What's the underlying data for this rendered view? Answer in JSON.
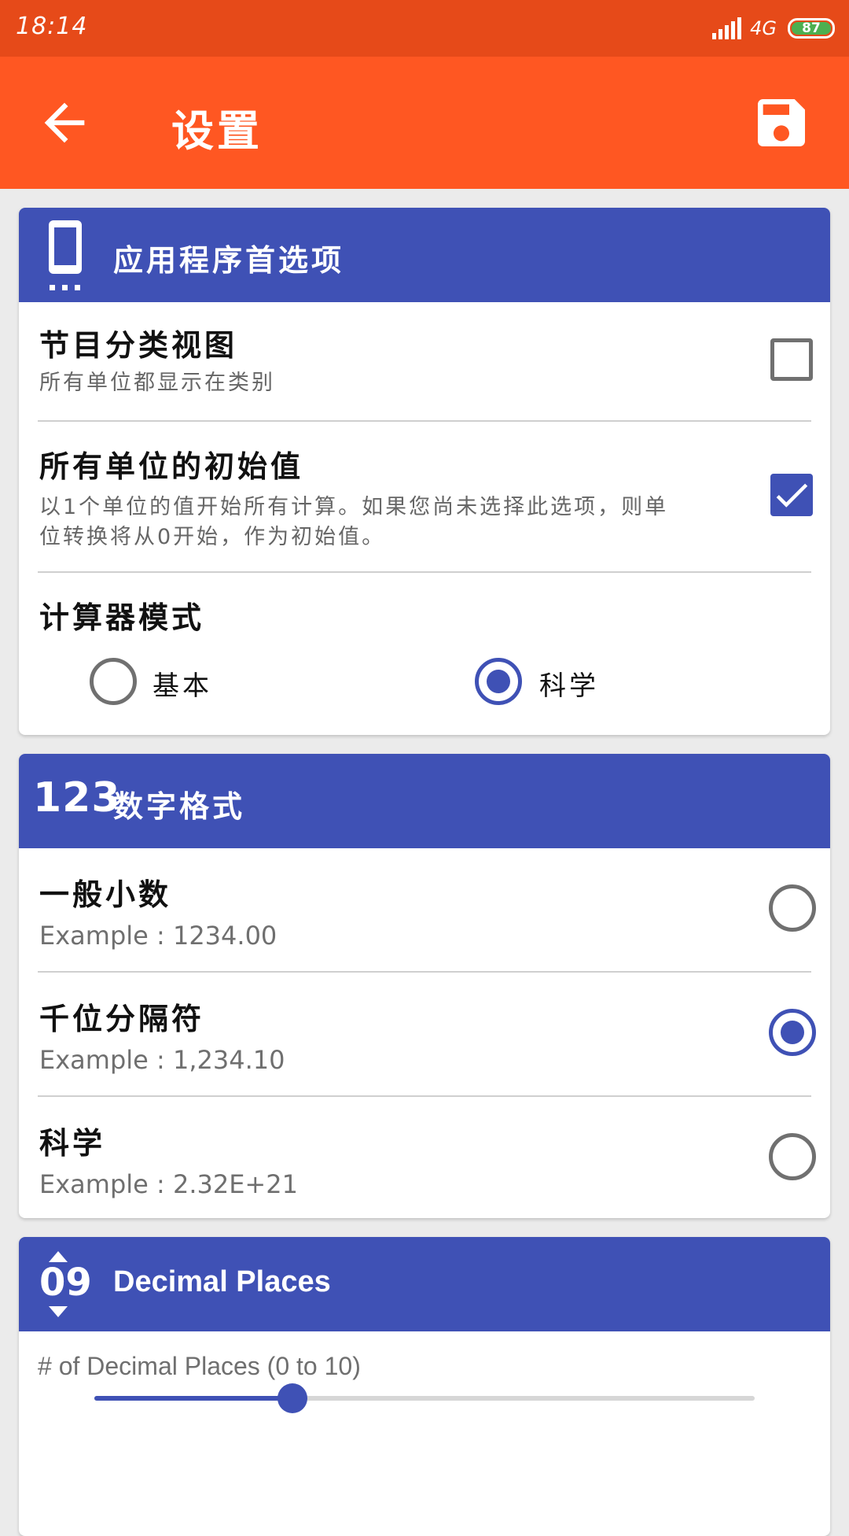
{
  "status_bar": {
    "time": "18:14",
    "network": "4G",
    "battery": "87"
  },
  "app_bar": {
    "title": "设置"
  },
  "app_prefs": {
    "header": "应用程序首选项",
    "category_view": {
      "title": "节目分类视图",
      "subtitle": "所有单位都显示在类别",
      "checked": false
    },
    "initial_value": {
      "title": "所有单位的初始值",
      "subtitle_line1": "以1个单位的值开始所有计算。如果您尚未选择此选项，则单",
      "subtitle_line2": "位转换将从0开始，作为初始值。",
      "checked": true
    },
    "calculator_mode": {
      "title": "计算器模式",
      "options": [
        {
          "label": "基本",
          "selected": false
        },
        {
          "label": "科学",
          "selected": true
        }
      ]
    }
  },
  "number_format": {
    "header": "数字格式",
    "icon_text": "123",
    "options": [
      {
        "title": "一般小数",
        "example": "Example : 1234.00",
        "selected": false
      },
      {
        "title": "千位分隔符",
        "example": "Example : 1,234.10",
        "selected": true
      },
      {
        "title": "科学",
        "example": "Example : 2.32E+21",
        "selected": false
      }
    ]
  },
  "decimal_places": {
    "header": "Decimal Places",
    "icon_text": "09",
    "label": "# of Decimal Places (0 to 10)",
    "value_fraction": 0.3,
    "min": 0,
    "max": 10
  },
  "colors": {
    "status_bar": "#e64a19",
    "app_bar": "#ff5722",
    "card_header": "#3f51b5",
    "accent": "#3f51b5",
    "background": "#ebebeb"
  }
}
